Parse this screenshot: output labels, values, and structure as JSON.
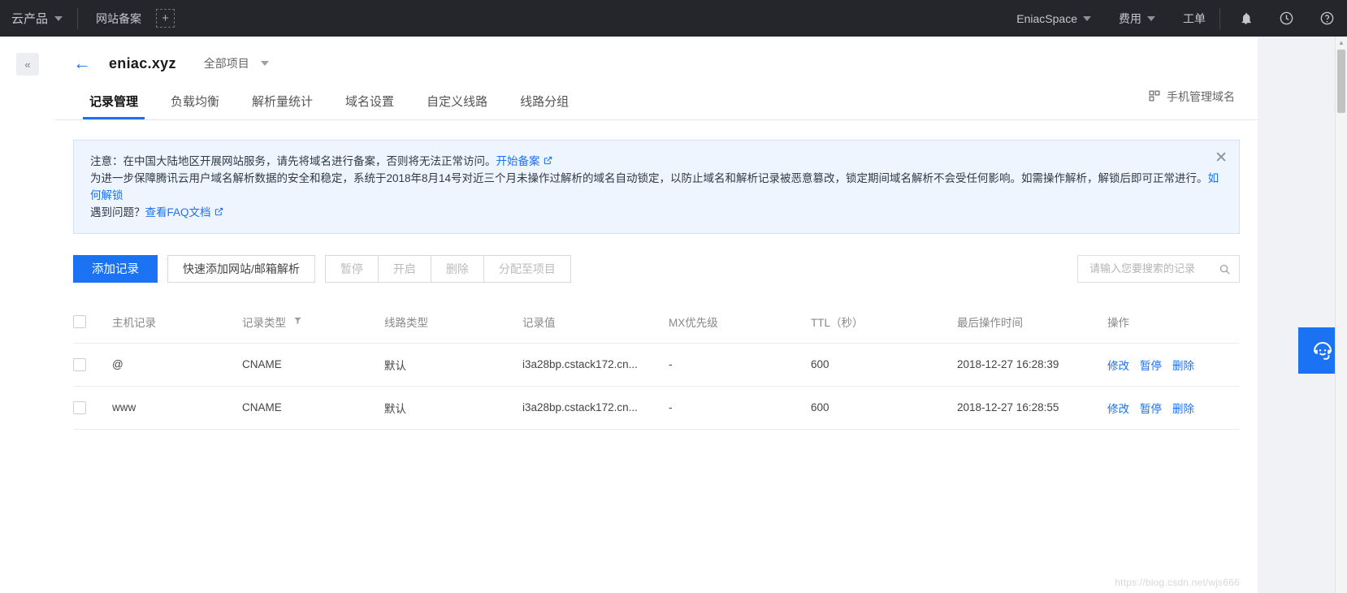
{
  "topbar": {
    "logo": "云产品",
    "tabs": [
      {
        "label": "网站备案"
      }
    ],
    "add_label": "+",
    "right_items": [
      {
        "label": "EniacSpace",
        "caret": true
      },
      {
        "label": "费用",
        "caret": true
      },
      {
        "label": "工单",
        "caret": false
      }
    ],
    "icons": [
      "bell-icon",
      "clock-icon",
      "help-icon"
    ]
  },
  "rail": {
    "collapse_label": "«"
  },
  "header": {
    "back": "←",
    "title": "eniac.xyz",
    "project_selector": "全部项目",
    "mobile_manage": "手机管理域名"
  },
  "tabs": [
    {
      "label": "记录管理",
      "active": true
    },
    {
      "label": "负载均衡",
      "active": false
    },
    {
      "label": "解析量统计",
      "active": false
    },
    {
      "label": "域名设置",
      "active": false
    },
    {
      "label": "自定义线路",
      "active": false
    },
    {
      "label": "线路分组",
      "active": false
    }
  ],
  "notice": {
    "line1_pre": "注意：在中国大陆地区开展网站服务，请先将域名进行备案，否则将无法正常访问。",
    "line1_link": "开始备案",
    "line2": "为进一步保障腾讯云用户域名解析数据的安全和稳定，系统于2018年8月14号对近三个月未操作过解析的域名自动锁定，以防止域名和解析记录被恶意篡改，锁定期间域名解析不会受任何影响。如需操作解析，解锁后即可正常进行。",
    "line2_link": "如何解锁",
    "line3_pre": "遇到问题？",
    "line3_link": "查看FAQ文档",
    "close": "✕"
  },
  "toolbar": {
    "add_record": "添加记录",
    "quick_add": "快速添加网站/邮箱解析",
    "pause": "暂停",
    "enable": "开启",
    "delete": "删除",
    "assign": "分配至项目",
    "search_placeholder": "请输入您要搜索的记录",
    "search_value": ""
  },
  "table": {
    "columns": [
      "主机记录",
      "记录类型",
      "线路类型",
      "记录值",
      "MX优先级",
      "TTL（秒）",
      "最后操作时间",
      "操作"
    ],
    "rows": [
      {
        "host": "@",
        "type": "CNAME",
        "line": "默认",
        "value": "i3a28bp.cstack172.cn...",
        "mx": "-",
        "ttl": "600",
        "time": "2018-12-27 16:28:39",
        "actions": [
          "修改",
          "暂停",
          "删除"
        ]
      },
      {
        "host": "www",
        "type": "CNAME",
        "line": "默认",
        "value": "i3a28bp.cstack172.cn...",
        "mx": "-",
        "ttl": "600",
        "time": "2018-12-27 16:28:55",
        "actions": [
          "修改",
          "暂停",
          "删除"
        ]
      }
    ]
  },
  "watermark": "https://blog.csdn.net/wjs666",
  "colors": {
    "accent": "#1b72f2",
    "topbar_bg": "#24262b",
    "notice_bg": "#eef5fe"
  }
}
